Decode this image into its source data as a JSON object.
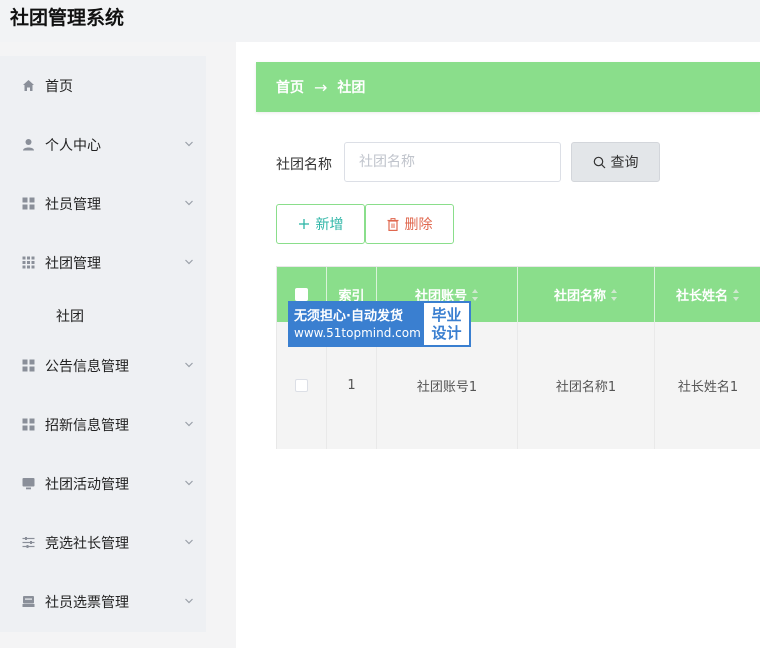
{
  "app_title": "社团管理系统",
  "sidebar": {
    "items": [
      {
        "label": "首页",
        "icon": "home-icon"
      },
      {
        "label": "个人中心",
        "icon": "user-icon"
      },
      {
        "label": "社员管理",
        "icon": "grid-icon"
      },
      {
        "label": "社团管理",
        "icon": "grid-icon"
      },
      {
        "label": "公告信息管理",
        "icon": "grid-icon"
      },
      {
        "label": "招新信息管理",
        "icon": "grid-icon"
      },
      {
        "label": "社团活动管理",
        "icon": "monitor-icon"
      },
      {
        "label": "竞选社长管理",
        "icon": "sliders-icon"
      },
      {
        "label": "社员选票管理",
        "icon": "ballot-icon"
      }
    ],
    "sub_item": "社团"
  },
  "breadcrumb": {
    "home": "首页",
    "separator": "→",
    "current": "社团"
  },
  "search": {
    "label": "社团名称",
    "placeholder": "社团名称",
    "value": "",
    "button": "查询"
  },
  "actions": {
    "add": "新增",
    "delete": "删除"
  },
  "table": {
    "columns": [
      "索引",
      "社团账号",
      "社团名称",
      "社长姓名"
    ],
    "rows": [
      {
        "index": "1",
        "account": "社团账号1",
        "name": "社团名称1",
        "leader": "社长姓名1"
      }
    ]
  },
  "watermark": {
    "line1": "无须担心·自动发货",
    "line2": "www.51topmind.com",
    "right1": "毕业",
    "right2": "设计"
  },
  "colors": {
    "accent": "#8ade8b",
    "add_text": "#2fb6a7",
    "delete_text": "#e0684f",
    "watermark_blue": "#3a7fd0"
  }
}
